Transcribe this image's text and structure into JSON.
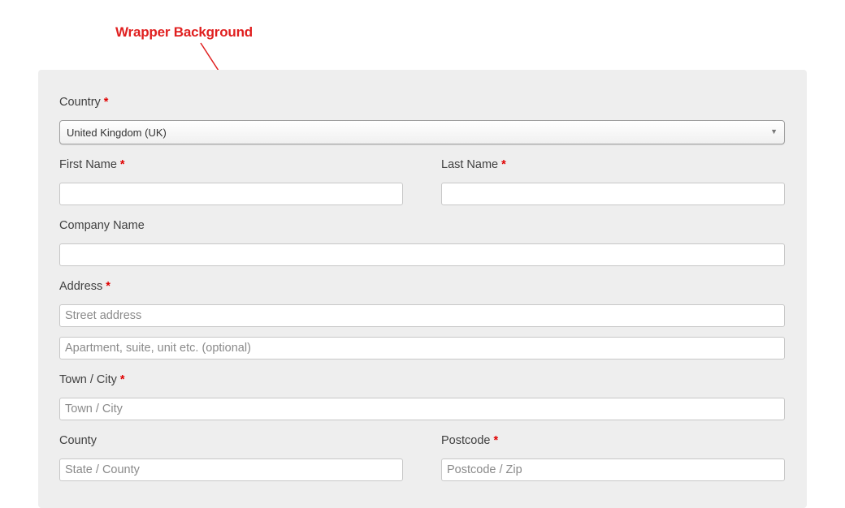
{
  "annotation": {
    "text": "Wrapper Background",
    "color": "#e02020"
  },
  "form": {
    "required_marker": "*",
    "country": {
      "label": "Country",
      "selected": "United Kingdom (UK)"
    },
    "first_name": {
      "label": "First Name",
      "value": ""
    },
    "last_name": {
      "label": "Last Name",
      "value": ""
    },
    "company": {
      "label": "Company Name",
      "value": ""
    },
    "address": {
      "label": "Address",
      "line1_placeholder": "Street address",
      "line2_placeholder": "Apartment, suite, unit etc. (optional)"
    },
    "city": {
      "label": "Town / City",
      "placeholder": "Town / City"
    },
    "county": {
      "label": "County",
      "placeholder": "State / County"
    },
    "postcode": {
      "label": "Postcode",
      "placeholder": "Postcode / Zip"
    }
  },
  "colors": {
    "wrapper_bg": "#eeeeee",
    "required": "#e00000"
  },
  "icons": {
    "select_arrow": "chevron-down-icon"
  }
}
